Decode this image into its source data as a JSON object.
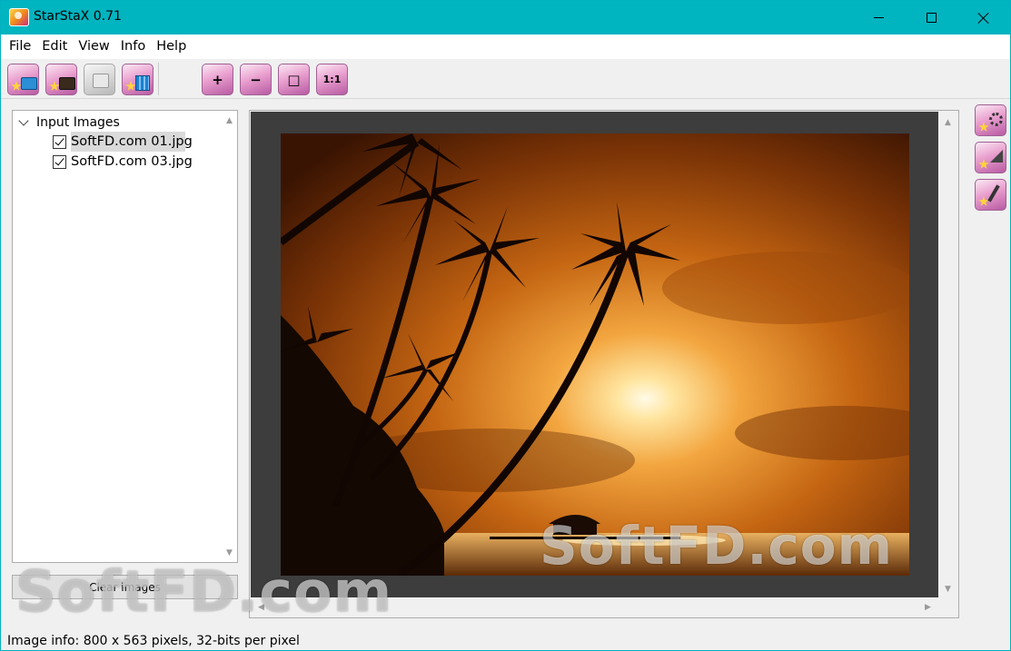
{
  "window": {
    "title": "StarStaX 0.71"
  },
  "menu": [
    "File",
    "Edit",
    "View",
    "Info",
    "Help"
  ],
  "toolbar": {
    "zoom_in": "+",
    "zoom_out": "−",
    "fit": "□",
    "actual_size": "1:1"
  },
  "tree": {
    "root_label": "Input Images",
    "items": [
      {
        "label": "SoftFD.com 01.jpg",
        "checked": true,
        "selected": true
      },
      {
        "label": "SoftFD.com 03.jpg",
        "checked": true,
        "selected": false
      }
    ]
  },
  "clear_button": "Clear images",
  "status": "Image info: 800 x 563 pixels, 32-bits per pixel",
  "watermark": "SoftFD.com",
  "colors": {
    "titlebar": "#00b4c0",
    "accent_button": "#e99fce",
    "canvas": "#3d3d3d"
  }
}
